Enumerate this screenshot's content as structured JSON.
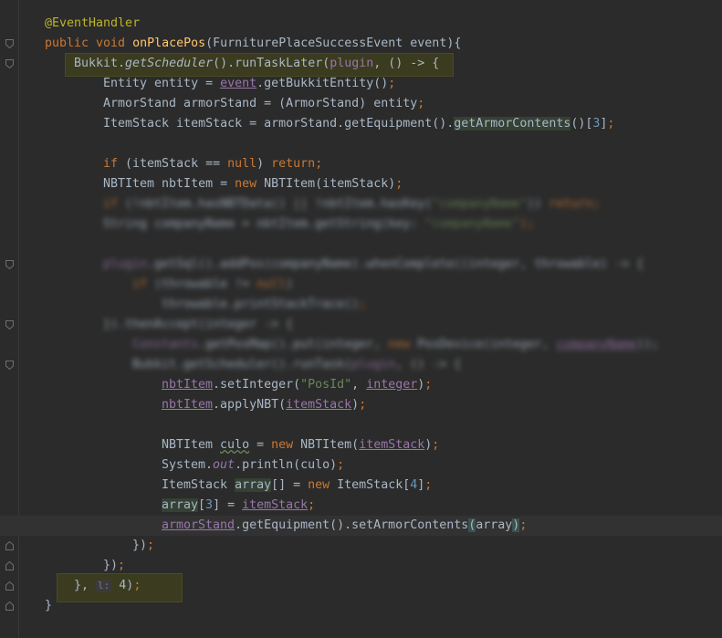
{
  "lines": [
    {
      "id": "l1",
      "tokens": [
        {
          "t": "@EventHandler",
          "c": "ann"
        }
      ]
    },
    {
      "id": "l2",
      "tokens": [
        {
          "t": "public void ",
          "c": "kw"
        },
        {
          "t": "onPlacePos",
          "c": "fn"
        },
        {
          "t": "(FurniturePlaceSuccessEvent event){",
          "c": ""
        }
      ]
    },
    {
      "id": "l3",
      "tokens": [
        {
          "t": "Bukkit.",
          "c": ""
        },
        {
          "t": "getScheduler",
          "c": "italic"
        },
        {
          "t": "().runTaskLater(",
          "c": ""
        },
        {
          "t": "plugin",
          "c": "field"
        },
        {
          "t": ", () -> {",
          "c": ""
        }
      ]
    },
    {
      "id": "l4",
      "tokens": [
        {
          "t": "Entity entity = ",
          "c": ""
        },
        {
          "t": "event",
          "c": "fieldul"
        },
        {
          "t": ".getBukkitEntity()",
          "c": ""
        },
        {
          "t": ";",
          "c": "kw"
        }
      ]
    },
    {
      "id": "l5",
      "tokens": [
        {
          "t": "ArmorStand armorStand = (ArmorStand) entity",
          "c": ""
        },
        {
          "t": ";",
          "c": "kw"
        }
      ]
    },
    {
      "id": "l6",
      "tokens": [
        {
          "t": "ItemStack itemStack = armorStand.getEquipment().",
          "c": ""
        },
        {
          "t": "getArmorContents",
          "c": "hl-word"
        },
        {
          "t": "()[",
          "c": ""
        },
        {
          "t": "3",
          "c": "num"
        },
        {
          "t": "]",
          "c": ""
        },
        {
          "t": ";",
          "c": "kw"
        }
      ]
    },
    {
      "id": "l7",
      "tokens": []
    },
    {
      "id": "l8",
      "tokens": [
        {
          "t": "if ",
          "c": "kw"
        },
        {
          "t": "(itemStack == ",
          "c": ""
        },
        {
          "t": "null",
          "c": "kw"
        },
        {
          "t": ") ",
          "c": ""
        },
        {
          "t": "return;",
          "c": "kw"
        }
      ]
    },
    {
      "id": "l9",
      "tokens": [
        {
          "t": "NBTItem nbtItem = ",
          "c": ""
        },
        {
          "t": "new ",
          "c": "kw"
        },
        {
          "t": "NBTItem(itemStack)",
          "c": ""
        },
        {
          "t": ";",
          "c": "kw"
        }
      ]
    },
    {
      "id": "l10",
      "blur": true,
      "tokens": [
        {
          "t": "if ",
          "c": "kw"
        },
        {
          "t": "(!nbtItem.hasNBTData() || !nbtItem.hasKey(",
          "c": ""
        },
        {
          "t": "\"companyName\"",
          "c": "str"
        },
        {
          "t": ")) ",
          "c": ""
        },
        {
          "t": "return;",
          "c": "kw"
        }
      ]
    },
    {
      "id": "l11",
      "blur": true,
      "tokens": [
        {
          "t": "String companyName = nbtItem.getString(",
          "c": ""
        },
        {
          "t": "key: ",
          "c": ""
        },
        {
          "t": "\"companyName\"",
          "c": "str"
        },
        {
          "t": ");",
          "c": "kw"
        }
      ]
    },
    {
      "id": "l12",
      "tokens": []
    },
    {
      "id": "l13",
      "blur": true,
      "tokens": [
        {
          "t": "plugin",
          "c": "field"
        },
        {
          "t": ".getSql().addPos(companyName).whenComplete((integer, throwable) -> {",
          "c": ""
        }
      ]
    },
    {
      "id": "l14",
      "blur": true,
      "tokens": [
        {
          "t": "if ",
          "c": "kw"
        },
        {
          "t": "(throwable != ",
          "c": ""
        },
        {
          "t": "null",
          "c": "kw"
        },
        {
          "t": ")",
          "c": ""
        }
      ]
    },
    {
      "id": "l15",
      "blur": true,
      "tokens": [
        {
          "t": "throwable.printStackTrace()",
          "c": ""
        },
        {
          "t": ";",
          "c": "kw"
        }
      ]
    },
    {
      "id": "l16",
      "blur": true,
      "tokens": [
        {
          "t": "}).thenAccept(integer -> {",
          "c": ""
        }
      ]
    },
    {
      "id": "l17",
      "blur": true,
      "tokens": [
        {
          "t": "Constants",
          "c": "field"
        },
        {
          "t": ".getPosMap().put(integer, ",
          "c": ""
        },
        {
          "t": "new ",
          "c": "kw"
        },
        {
          "t": "PosDevice(integer, ",
          "c": ""
        },
        {
          "t": "companyName",
          "c": "fieldul"
        },
        {
          "t": "));",
          "c": ""
        }
      ]
    },
    {
      "id": "l18",
      "blur": true,
      "tokens": [
        {
          "t": "Bukkit.getScheduler().runTask(",
          "c": ""
        },
        {
          "t": "plugin",
          "c": "field"
        },
        {
          "t": ", () -> {",
          "c": ""
        }
      ]
    },
    {
      "id": "l19",
      "tokens": [
        {
          "t": "nbtItem",
          "c": "fieldul"
        },
        {
          "t": ".setInteger(",
          "c": ""
        },
        {
          "t": "\"PosId\"",
          "c": "str"
        },
        {
          "t": ", ",
          "c": ""
        },
        {
          "t": "integer",
          "c": "fieldul"
        },
        {
          "t": ")",
          "c": ""
        },
        {
          "t": ";",
          "c": "kw"
        }
      ]
    },
    {
      "id": "l20",
      "tokens": [
        {
          "t": "nbtItem",
          "c": "fieldul"
        },
        {
          "t": ".applyNBT(",
          "c": ""
        },
        {
          "t": "itemStack",
          "c": "fieldul"
        },
        {
          "t": ")",
          "c": ""
        },
        {
          "t": ";",
          "c": "kw"
        }
      ]
    },
    {
      "id": "l21",
      "tokens": []
    },
    {
      "id": "l22",
      "tokens": [
        {
          "t": "NBTItem ",
          "c": ""
        },
        {
          "t": "culo",
          "c": "squig"
        },
        {
          "t": " = ",
          "c": ""
        },
        {
          "t": "new ",
          "c": "kw"
        },
        {
          "t": "NBTItem(",
          "c": ""
        },
        {
          "t": "itemStack",
          "c": "fieldul"
        },
        {
          "t": ")",
          "c": ""
        },
        {
          "t": ";",
          "c": "kw"
        }
      ]
    },
    {
      "id": "l23",
      "tokens": [
        {
          "t": "System.",
          "c": ""
        },
        {
          "t": "out",
          "c": "field italic"
        },
        {
          "t": ".println(culo)",
          "c": ""
        },
        {
          "t": ";",
          "c": "kw"
        }
      ]
    },
    {
      "id": "l24",
      "tokens": [
        {
          "t": "ItemStack ",
          "c": ""
        },
        {
          "t": "array",
          "c": "hl-word"
        },
        {
          "t": "[] = ",
          "c": ""
        },
        {
          "t": "new ",
          "c": "kw"
        },
        {
          "t": "ItemStack[",
          "c": ""
        },
        {
          "t": "4",
          "c": "num"
        },
        {
          "t": "]",
          "c": ""
        },
        {
          "t": ";",
          "c": "kw"
        }
      ]
    },
    {
      "id": "l25",
      "tokens": [
        {
          "t": "array",
          "c": "hl-word"
        },
        {
          "t": "[",
          "c": ""
        },
        {
          "t": "3",
          "c": "num"
        },
        {
          "t": "] = ",
          "c": ""
        },
        {
          "t": "itemStack",
          "c": "fieldul"
        },
        {
          "t": ";",
          "c": "kw"
        }
      ]
    },
    {
      "id": "l26",
      "tokens": [
        {
          "t": "armorStand",
          "c": "fieldul"
        },
        {
          "t": ".getEquipment().setArmorContents",
          "c": ""
        },
        {
          "t": "(",
          "c": "match"
        },
        {
          "t": "array",
          "c": ""
        },
        {
          "t": ")",
          "c": "match"
        },
        {
          "t": ";",
          "c": "kw"
        }
      ]
    },
    {
      "id": "l27",
      "tokens": [
        {
          "t": "})",
          "c": ""
        },
        {
          "t": ";",
          "c": "kw"
        }
      ]
    },
    {
      "id": "l28",
      "tokens": [
        {
          "t": "})",
          "c": ""
        },
        {
          "t": ";",
          "c": "kw"
        }
      ]
    },
    {
      "id": "l29",
      "tokens": [
        {
          "t": "}, ",
          "c": ""
        },
        {
          "t": "l:",
          "c": "hint"
        },
        {
          "t": " 4)",
          "c": ""
        },
        {
          "t": ";",
          "c": "kw"
        }
      ]
    },
    {
      "id": "l30",
      "tokens": [
        {
          "t": "}",
          "c": ""
        }
      ]
    }
  ]
}
